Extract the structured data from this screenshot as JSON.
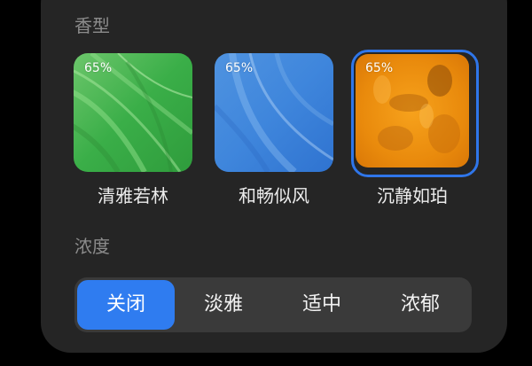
{
  "scent_section": {
    "label": "香型",
    "options": [
      {
        "name": "清雅若林",
        "percent": "65%",
        "texture": "green-grass"
      },
      {
        "name": "和畅似风",
        "percent": "65%",
        "texture": "blue-wind"
      },
      {
        "name": "沉静如珀",
        "percent": "65%",
        "texture": "amber-orange"
      }
    ],
    "selected_index": 2
  },
  "intensity_section": {
    "label": "浓度",
    "options": [
      "关闭",
      "淡雅",
      "适中",
      "浓郁"
    ],
    "selected_index": 0
  },
  "colors": {
    "accent": "#2f7cf0",
    "panel_bg": "#252525",
    "segment_bg": "#3a3a3a",
    "label_gray": "#8c8c8c",
    "text_light": "#ececec"
  }
}
